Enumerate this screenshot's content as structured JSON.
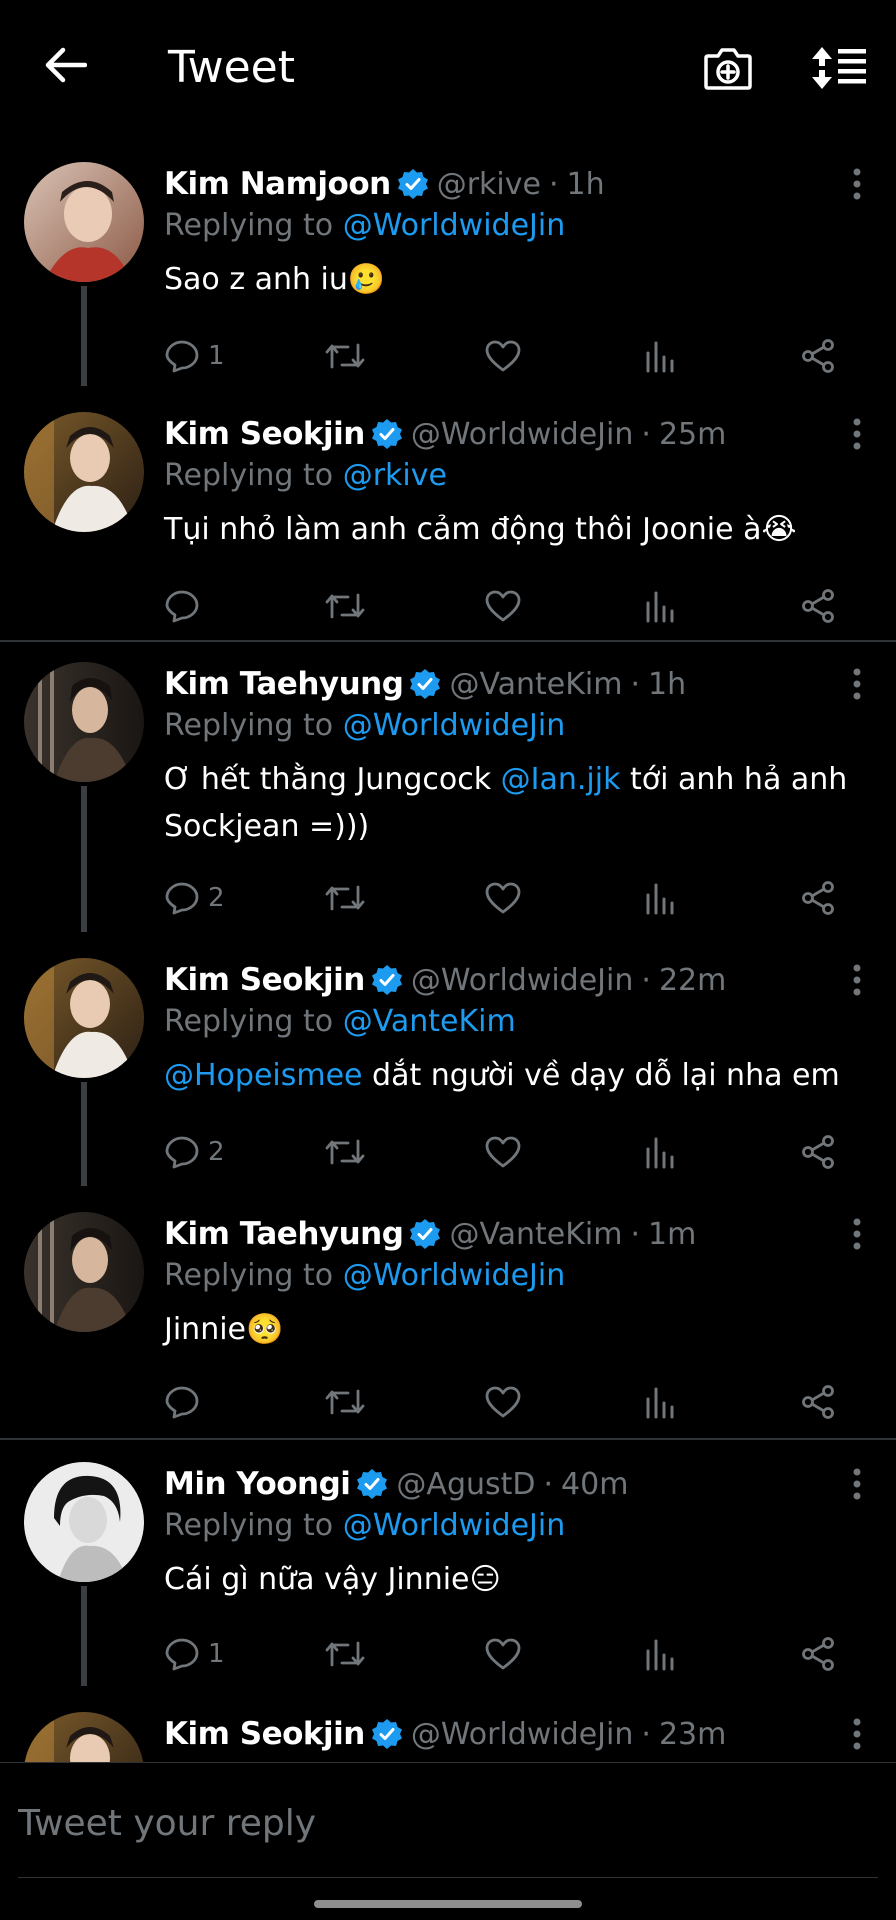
{
  "header": {
    "title": "Tweet",
    "back_icon": "arrow-left-icon",
    "camera_icon": "camera-plus-icon",
    "sort_icon": "sort-replies-icon"
  },
  "colors": {
    "accent": "#1d9bf0",
    "muted": "#71767b",
    "background": "#000000"
  },
  "tweets": [
    {
      "name": "Kim Namjoon",
      "handle": "@rkive",
      "time": "1h",
      "replying_label": "Replying to",
      "replying_to": "@WorldwideJin",
      "text": "Sao z anh iu",
      "emoji": "🥲",
      "replies": "1"
    },
    {
      "name": "Kim Seokjin",
      "handle": "@WorldwideJin",
      "time": "25m",
      "replying_label": "Replying to",
      "replying_to": "@rkive",
      "text": "Tụi nhỏ làm anh cảm động thôi Joonie à",
      "emoji": "😭",
      "replies": ""
    },
    {
      "name": "Kim Taehyung",
      "handle": "@VanteKim",
      "time": "1h",
      "replying_label": "Replying to",
      "replying_to": "@WorldwideJin",
      "text_before": "Ơ hết thằng Jungcock ",
      "text_mention": "@Ian.jjk",
      "text_after": " tới anh hả anh Sockjean =)))",
      "replies": "2"
    },
    {
      "name": "Kim Seokjin",
      "handle": "@WorldwideJin",
      "time": "22m",
      "replying_label": "Replying to",
      "replying_to": "@VanteKim",
      "text_mention": "@Hopeismee",
      "text_after": " dắt người về dạy dỗ lại nha em",
      "replies": "2"
    },
    {
      "name": "Kim Taehyung",
      "handle": "@VanteKim",
      "time": "1m",
      "replying_label": "Replying to",
      "replying_to": "@WorldwideJin",
      "text": "Jinnie",
      "emoji": "🥺",
      "replies": ""
    },
    {
      "name": "Min Yoongi",
      "handle": "@AgustD",
      "time": "40m",
      "replying_label": "Replying to",
      "replying_to": "@WorldwideJin",
      "text": "Cái gì nữa vậy Jinnie",
      "emoji": "😑",
      "replies": "1"
    },
    {
      "name": "Kim Seokjin",
      "handle": "@WorldwideJin",
      "time": "23m"
    }
  ],
  "reply_bar": {
    "placeholder": "Tweet your reply"
  }
}
